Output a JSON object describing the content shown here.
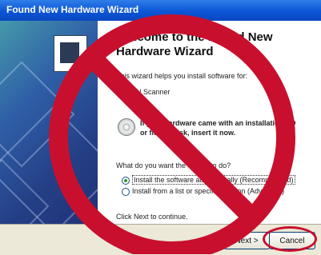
{
  "window": {
    "title": "Found New Hardware Wizard"
  },
  "wizard": {
    "heading": "Welcome to the Found New\nHardware Wizard",
    "intro": "This wizard helps you install software for:",
    "device": "EPSON Scanner",
    "cd_instruction": "If your hardware came with an installation CD\nor floppy disk, insert it now.",
    "question": "What do you want the wizard to do?",
    "options": [
      {
        "label": "Install the software automatically (Recommended)",
        "selected": true
      },
      {
        "label": "Install from a list or specific location (Advanced)",
        "selected": false
      }
    ],
    "continue_text": "Click Next to continue."
  },
  "buttons": {
    "next": "Next >",
    "cancel": "Cancel"
  },
  "overlay": {
    "type": "prohibition-sign",
    "color": "#c8102e",
    "cancel_highlight_color": "#c8102e"
  }
}
